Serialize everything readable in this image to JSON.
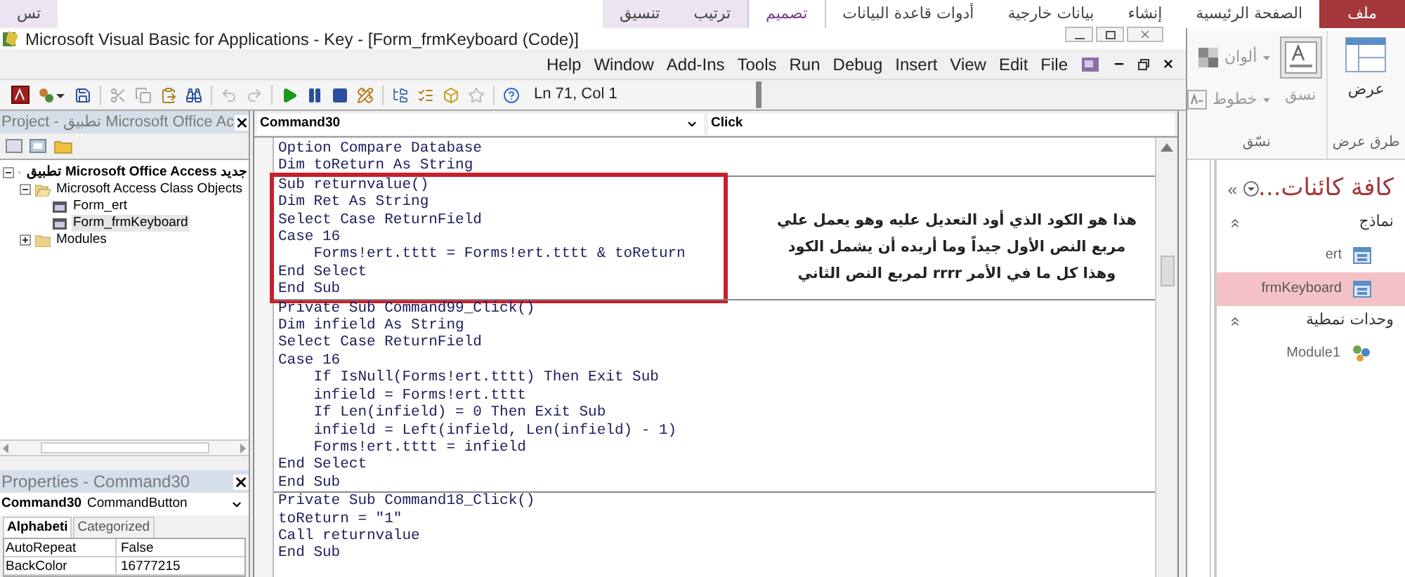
{
  "access": {
    "ribbon_tabs": [
      {
        "label": "ملف",
        "kind": "file",
        "selected": false
      },
      {
        "label": "الصفحة الرئيسية",
        "kind": "normal",
        "selected": false
      },
      {
        "label": "إنشاء",
        "kind": "normal",
        "selected": false
      },
      {
        "label": "بيانات خارجية",
        "kind": "normal",
        "selected": false
      },
      {
        "label": "أدوات قاعدة البيانات",
        "kind": "normal",
        "selected": false
      },
      {
        "label": "تصميم",
        "kind": "contextual",
        "selected": true
      },
      {
        "label": "ترتيب",
        "kind": "contextual",
        "selected": false
      },
      {
        "label": "تنسيق",
        "kind": "contextual",
        "selected": false
      },
      {
        "label": "تس",
        "kind": "contextual",
        "selected": false
      }
    ],
    "ribbon_groups": [
      {
        "label": "طرق عرض",
        "buttons": [
          {
            "label": "عرض",
            "kind": "view",
            "disabled": false
          }
        ]
      },
      {
        "label": "نسّق",
        "buttons": [
          {
            "label": "نسق",
            "kind": "theme",
            "disabled": true
          },
          {
            "label": "ألوان",
            "kind": "colors",
            "disabled": true
          },
          {
            "label": "خطوط",
            "kind": "fonts",
            "disabled": true
          }
        ]
      }
    ],
    "nav_pane": {
      "title": "كافة كائنات...",
      "shutter": "»",
      "groups": [
        {
          "label": "نماذج",
          "expanded": true,
          "items": [
            {
              "label": "ert",
              "kind": "form",
              "selected": false
            },
            {
              "label": "frmKeyboard",
              "kind": "form",
              "selected": true
            }
          ]
        },
        {
          "label": "وحدات نمطية",
          "expanded": true,
          "items": [
            {
              "label": "Module1",
              "kind": "module",
              "selected": false
            }
          ]
        }
      ]
    }
  },
  "vba": {
    "title": "Microsoft Visual Basic for Applications - Key - [Form_frmKeyboard (Code)]",
    "menu": [
      "Help",
      "Window",
      "Add-Ins",
      "Tools",
      "Run",
      "Debug",
      "Insert",
      "View",
      "Edit",
      "File"
    ],
    "position": "Ln 71, Col 1",
    "project": {
      "title": "Project - تطبيق Microsoft Office Ac",
      "tree": [
        {
          "label": "تطبيق Microsoft Office Access جديد",
          "kind": "project",
          "expanded": true,
          "selected": false,
          "children": [
            {
              "label": "Microsoft Access Class Objects",
              "kind": "folder",
              "expanded": true,
              "selected": false,
              "children": [
                {
                  "label": "Form_ert",
                  "kind": "form",
                  "selected": false
                },
                {
                  "label": "Form_frmKeyboard",
                  "kind": "form",
                  "selected": true
                }
              ]
            },
            {
              "label": "Modules",
              "kind": "folder",
              "expanded": false,
              "selected": false
            }
          ]
        }
      ]
    },
    "properties": {
      "title": "Properties - Command30",
      "object_name": "Command30",
      "object_type": "CommandButton",
      "tabs": [
        {
          "label": "Alphabeti",
          "selected": true
        },
        {
          "label": "Categorized",
          "selected": false
        }
      ],
      "rows": [
        {
          "name": "AutoRepeat",
          "value": "False"
        },
        {
          "name": "BackColor",
          "value": "16777215"
        }
      ]
    },
    "code": {
      "object": "Command30",
      "procedure": "Click",
      "blocks": [
        {
          "boxed": false,
          "lines": [
            "Option Compare Database",
            "Dim toReturn As String"
          ]
        },
        {
          "boxed": true,
          "lines": [
            "Sub returnvalue()",
            "Dim Ret As String",
            "Select Case ReturnField",
            "Case 16",
            "    Forms!ert.tttt = Forms!ert.tttt & toReturn",
            "End Select",
            "End Sub"
          ]
        },
        {
          "boxed": false,
          "lines": [
            "Private Sub Command99_Click()",
            "Dim infield As String",
            "Select Case ReturnField",
            "Case 16",
            "    If IsNull(Forms!ert.tttt) Then Exit Sub",
            "    infield = Forms!ert.tttt",
            "    If Len(infield) = 0 Then Exit Sub",
            "    infield = Left(infield, Len(infield) - 1)",
            "    Forms!ert.tttt = infield",
            "End Select",
            "End Sub"
          ]
        },
        {
          "boxed": false,
          "lines": [
            "Private Sub Command18_Click()",
            "toReturn = \"1\"",
            "Call returnvalue",
            "End Sub"
          ]
        }
      ],
      "note": [
        "هذا هو الكود الذي أود التعديل عليه وهو يعمل علي",
        "مربع النص الأول جيداً وما أريده أن يشمل الكود",
        "وهذا كل ما في الأمر rrrr لمربع النص الثاني"
      ]
    }
  }
}
